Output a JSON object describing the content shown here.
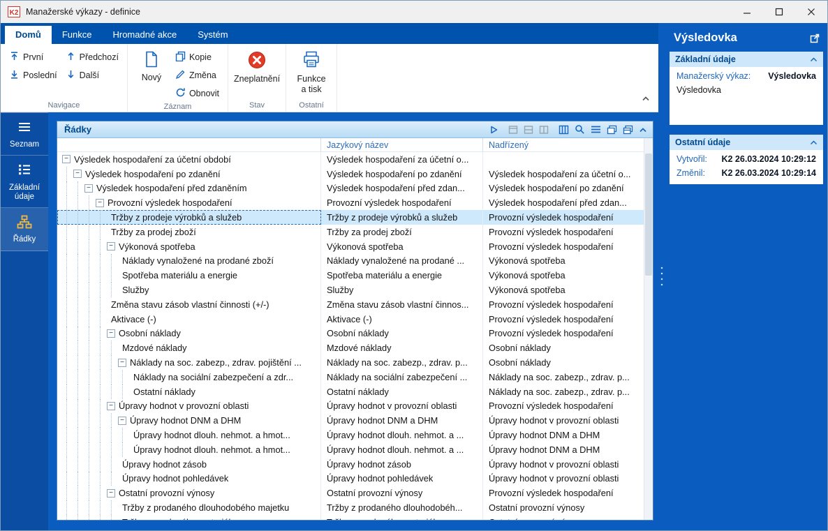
{
  "titlebar": {
    "title": "Manažerské výkazy - definice"
  },
  "tabs": [
    {
      "label": "Domů",
      "active": true
    },
    {
      "label": "Funkce",
      "active": false
    },
    {
      "label": "Hromadné akce",
      "active": false
    },
    {
      "label": "Systém",
      "active": false
    }
  ],
  "ribbon": {
    "groups": {
      "navigace": {
        "label": "Navigace",
        "first": "První",
        "last": "Poslední",
        "prev": "Předchozí",
        "next": "Další"
      },
      "zaznam": {
        "label": "Záznam",
        "new": "Nový",
        "copy": "Kopie",
        "change": "Změna",
        "refresh": "Obnovit"
      },
      "stav": {
        "label": "Stav",
        "invalidate": "Zneplatnění"
      },
      "ostatni": {
        "label": "Ostatní",
        "print": "Funkce a tisk"
      }
    }
  },
  "sidebar": {
    "items": [
      {
        "label": "Seznam"
      },
      {
        "label": "Základní údaje"
      },
      {
        "label": "Řádky"
      }
    ]
  },
  "panel": {
    "title": "Řádky",
    "toolbar_icons": [
      "play-icon",
      "form-view-icon",
      "table-view-icon",
      "split-view-icon",
      "columns-icon",
      "search-settings-icon",
      "menu-icon",
      "cascade-icon",
      "duplicate-icon",
      "collapse-panel-icon"
    ]
  },
  "grid": {
    "columns": {
      "name": "",
      "lang": "Jazykový název",
      "parent": "Nadřízený"
    },
    "rows": [
      {
        "level": 0,
        "expand": true,
        "selected": false,
        "name": "Výsledek hospodaření za účetní období",
        "lang": "Výsledek hospodaření za účetní o...",
        "parent": ""
      },
      {
        "level": 1,
        "expand": true,
        "selected": false,
        "name": "Výsledek hospodaření po zdanění",
        "lang": "Výsledek hospodaření po zdanění",
        "parent": "Výsledek hospodaření za účetní o..."
      },
      {
        "level": 2,
        "expand": true,
        "selected": false,
        "name": "Výsledek hospodaření před zdaněním",
        "lang": "Výsledek hospodaření před zdan...",
        "parent": "Výsledek hospodaření po zdanění"
      },
      {
        "level": 3,
        "expand": true,
        "selected": false,
        "name": "Provozní výsledek hospodaření",
        "lang": "Provozní výsledek hospodaření",
        "parent": "Výsledek hospodaření před zdan..."
      },
      {
        "level": 4,
        "expand": false,
        "selected": true,
        "name": "Tržby z prodeje výrobků a služeb",
        "lang": "Tržby z prodeje výrobků a služeb",
        "parent": "Provozní výsledek hospodaření"
      },
      {
        "level": 4,
        "expand": false,
        "selected": false,
        "name": "Tržby za prodej zboží",
        "lang": "Tržby za prodej zboží",
        "parent": "Provozní výsledek hospodaření"
      },
      {
        "level": 4,
        "expand": true,
        "selected": false,
        "name": "Výkonová spotřeba",
        "lang": "Výkonová spotřeba",
        "parent": "Provozní výsledek hospodaření"
      },
      {
        "level": 5,
        "expand": false,
        "selected": false,
        "name": "Náklady vynaložené na prodané zboží",
        "lang": "Náklady vynaložené na prodané ...",
        "parent": "Výkonová spotřeba"
      },
      {
        "level": 5,
        "expand": false,
        "selected": false,
        "name": "Spotřeba materiálu a energie",
        "lang": "Spotřeba materiálu a energie",
        "parent": "Výkonová spotřeba"
      },
      {
        "level": 5,
        "expand": false,
        "selected": false,
        "name": "Služby",
        "lang": "Služby",
        "parent": "Výkonová spotřeba"
      },
      {
        "level": 4,
        "expand": false,
        "selected": false,
        "name": "Změna stavu zásob vlastní činnosti (+/-)",
        "lang": "Změna stavu zásob vlastní činnos...",
        "parent": "Provozní výsledek hospodaření"
      },
      {
        "level": 4,
        "expand": false,
        "selected": false,
        "name": "Aktivace (-)",
        "lang": "Aktivace (-)",
        "parent": "Provozní výsledek hospodaření"
      },
      {
        "level": 4,
        "expand": true,
        "selected": false,
        "name": "Osobní náklady",
        "lang": "Osobní náklady",
        "parent": "Provozní výsledek hospodaření"
      },
      {
        "level": 5,
        "expand": false,
        "selected": false,
        "name": "Mzdové náklady",
        "lang": "Mzdové náklady",
        "parent": "Osobní náklady"
      },
      {
        "level": 5,
        "expand": true,
        "selected": false,
        "name": "Náklady na soc. zabezp., zdrav. pojištění ...",
        "lang": "Náklady na soc. zabezp., zdrav. p...",
        "parent": "Osobní náklady"
      },
      {
        "level": 6,
        "expand": false,
        "selected": false,
        "name": "Náklady na sociální zabezpečení a zdr...",
        "lang": "Náklady na sociální zabezpečení ...",
        "parent": "Náklady na soc. zabezp., zdrav. p..."
      },
      {
        "level": 6,
        "expand": false,
        "selected": false,
        "name": "Ostatní náklady",
        "lang": "Ostatní náklady",
        "parent": "Náklady na soc. zabezp., zdrav. p..."
      },
      {
        "level": 4,
        "expand": true,
        "selected": false,
        "name": "Úpravy hodnot v provozní oblasti",
        "lang": "Úpravy hodnot v provozní oblasti",
        "parent": "Provozní výsledek hospodaření"
      },
      {
        "level": 5,
        "expand": true,
        "selected": false,
        "name": "Úpravy hodnot DNM a DHM",
        "lang": "Úpravy hodnot DNM a DHM",
        "parent": "Úpravy hodnot v provozní oblasti"
      },
      {
        "level": 6,
        "expand": false,
        "selected": false,
        "name": "Úpravy hodnot dlouh. nehmot. a hmot...",
        "lang": "Úpravy hodnot dlouh. nehmot. a ...",
        "parent": "Úpravy hodnot DNM a DHM"
      },
      {
        "level": 6,
        "expand": false,
        "selected": false,
        "name": "Úpravy hodnot dlouh. nehmot. a hmot...",
        "lang": "Úpravy hodnot dlouh. nehmot. a ...",
        "parent": "Úpravy hodnot DNM a DHM"
      },
      {
        "level": 5,
        "expand": false,
        "selected": false,
        "name": "Úpravy hodnot zásob",
        "lang": "Úpravy hodnot zásob",
        "parent": "Úpravy hodnot v provozní oblasti"
      },
      {
        "level": 5,
        "expand": false,
        "selected": false,
        "name": "Úpravy hodnot pohledávek",
        "lang": "Úpravy hodnot pohledávek",
        "parent": "Úpravy hodnot v provozní oblasti"
      },
      {
        "level": 4,
        "expand": true,
        "selected": false,
        "name": "Ostatní provozní výnosy",
        "lang": "Ostatní provozní výnosy",
        "parent": "Provozní výsledek hospodaření"
      },
      {
        "level": 5,
        "expand": false,
        "selected": false,
        "name": "Tržby z prodaného dlouhodobého majetku",
        "lang": "Tržby z prodaného dlouhodobéh...",
        "parent": "Ostatní provozní výnosy"
      },
      {
        "level": 5,
        "expand": false,
        "selected": false,
        "name": "Tržby z prodaného materiálu",
        "lang": "Tržby z prodaného materiálu",
        "parent": "Ostatní provozní výnosy"
      }
    ]
  },
  "right_panel": {
    "title": "Výsledovka",
    "basic": {
      "title": "Základní údaje",
      "report_label": "Manažerský výkaz:",
      "report_value": "Výsledovka",
      "report_name": "Výsledovka"
    },
    "other": {
      "title": "Ostatní údaje",
      "created_label": "Vytvořil:",
      "created_value": "K2 26.03.2024 10:29:12",
      "changed_label": "Změnil:",
      "changed_value": "K2 26.03.2024 10:29:14"
    }
  },
  "colors": {
    "body_blue": "#0a5cbe",
    "tab_blue": "#0053ac",
    "sidebar_blue": "#0b4da2",
    "selection_blue": "#cfe9fc",
    "invalid_red": "#e23c28",
    "gold": "#f0b93c"
  }
}
